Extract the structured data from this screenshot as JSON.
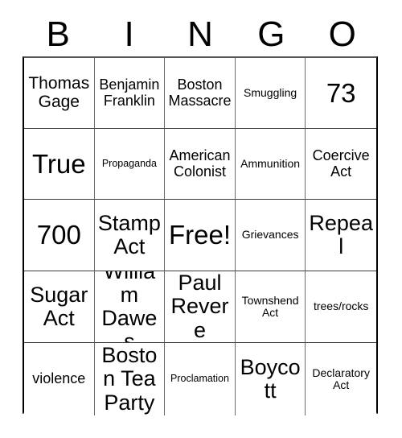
{
  "card": {
    "header_letters": [
      "B",
      "I",
      "N",
      "G",
      "O"
    ],
    "rows": [
      [
        {
          "text": "Thomas Gage",
          "size": "lg"
        },
        {
          "text": "Benjamin Franklin",
          "size": "md"
        },
        {
          "text": "Boston Massacre",
          "size": "md"
        },
        {
          "text": "Smuggling",
          "size": "sm"
        },
        {
          "text": "73",
          "size": "xxl"
        }
      ],
      [
        {
          "text": "True",
          "size": "xxl"
        },
        {
          "text": "Propaganda",
          "size": "xs"
        },
        {
          "text": "American Colonist",
          "size": "md"
        },
        {
          "text": "Ammunition",
          "size": "sm"
        },
        {
          "text": "Coercive Act",
          "size": "md"
        }
      ],
      [
        {
          "text": "700",
          "size": "xxl"
        },
        {
          "text": "Stamp Act",
          "size": "xl"
        },
        {
          "text": "Free!",
          "size": "xxl"
        },
        {
          "text": "Grievances",
          "size": "sm"
        },
        {
          "text": "Repeal",
          "size": "xl"
        }
      ],
      [
        {
          "text": "Sugar Act",
          "size": "xl"
        },
        {
          "text": "William Dawes",
          "size": "xl"
        },
        {
          "text": "Paul Revere",
          "size": "xl"
        },
        {
          "text": "Townshend Act",
          "size": "sm"
        },
        {
          "text": "trees/rocks",
          "size": "sm"
        }
      ],
      [
        {
          "text": "violence",
          "size": "md"
        },
        {
          "text": "Boston Tea Party",
          "size": "xl"
        },
        {
          "text": "Proclamation",
          "size": "xs"
        },
        {
          "text": "Boycott",
          "size": "xl"
        },
        {
          "text": "Declaratory Act",
          "size": "sm"
        }
      ]
    ]
  },
  "colors": {
    "background": "#ffffff",
    "text": "#000000",
    "grid_line": "#3a3a3a",
    "grid_border": "#000000"
  }
}
